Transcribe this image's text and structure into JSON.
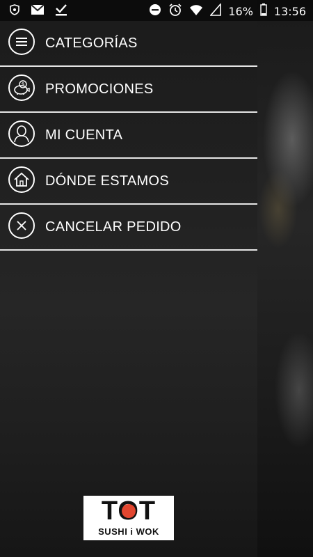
{
  "status_bar": {
    "battery": "16%",
    "time": "13:56",
    "icons": [
      "shield-icon",
      "gmail-icon",
      "download-done-icon",
      "do-not-disturb-icon",
      "alarm-icon",
      "wifi-icon",
      "signal-icon",
      "battery-icon"
    ]
  },
  "menu": {
    "items": [
      {
        "label": "CATEGORÍAS",
        "icon": "hamburger-icon"
      },
      {
        "label": "PROMOCIONES",
        "icon": "piggy-bank-icon"
      },
      {
        "label": "MI CUENTA",
        "icon": "user-icon"
      },
      {
        "label": "DÓNDE ESTAMOS",
        "icon": "home-icon"
      },
      {
        "label": "CANCELAR PEDIDO",
        "icon": "close-icon"
      }
    ]
  },
  "logo": {
    "name": "TOT",
    "tagline": "SUSHI i WOK"
  },
  "colors": {
    "drawer_bg": "#202020",
    "divider": "#e6e6e6",
    "text": "#ffffff",
    "logo_accent": "#e2462f"
  }
}
